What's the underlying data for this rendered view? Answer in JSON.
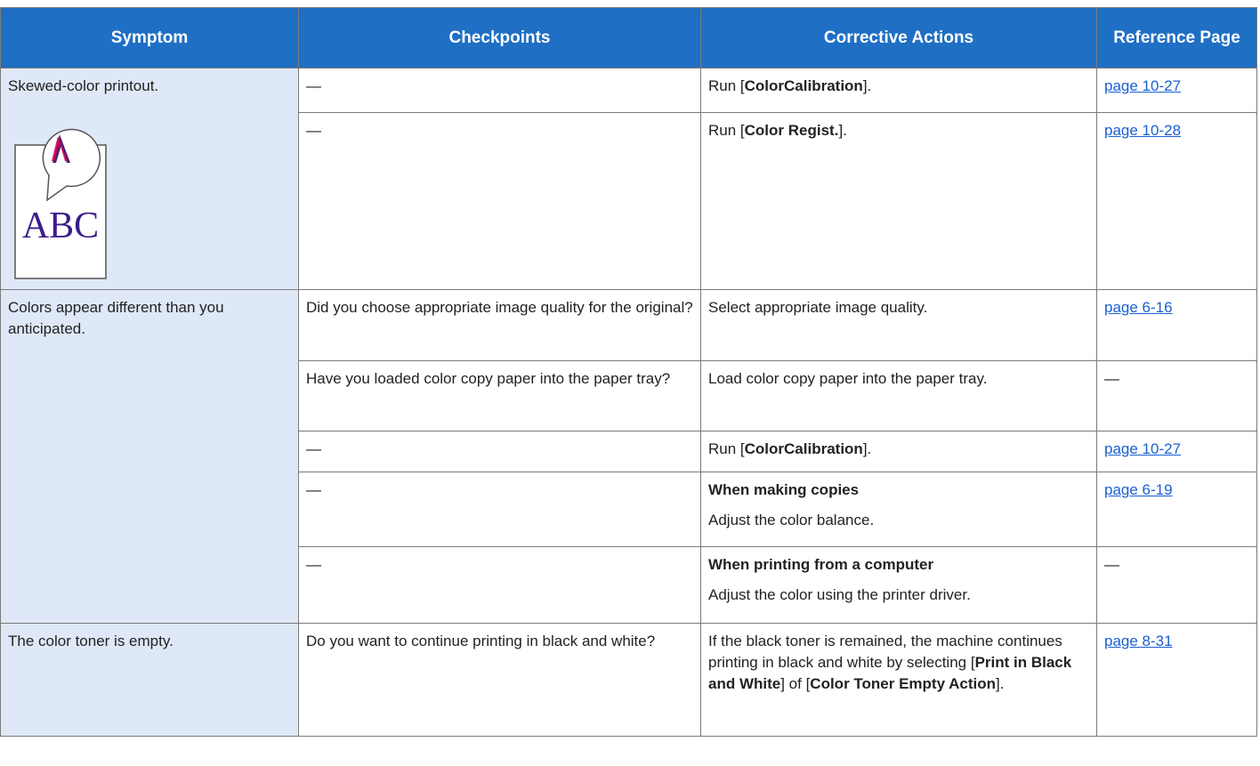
{
  "headers": {
    "symptom": "Symptom",
    "checkpoints": "Checkpoints",
    "corrective": "Corrective Actions",
    "reference": "Reference Page"
  },
  "dash": "—",
  "rows": [
    {
      "symptom": "Skewed-color printout.",
      "illustration_text": "ABC",
      "r1": {
        "check": "—",
        "action_pre": "Run [",
        "action_bold": "ColorCalibration",
        "action_post": "].",
        "ref": "page 10-27"
      },
      "r2": {
        "check": "—",
        "action_pre": "Run [",
        "action_bold": "Color Regist.",
        "action_post": "].",
        "ref": "page 10-28"
      }
    },
    {
      "symptom": "Colors appear different than you anticipated.",
      "r1": {
        "check": "Did you choose appropriate image quality for the original?",
        "action": "Select appropriate image quality.",
        "ref": "page 6-16"
      },
      "r2": {
        "check": "Have you loaded color copy paper into the paper tray?",
        "action": "Load color copy paper into the paper tray.",
        "ref": "—"
      },
      "r3": {
        "check": "—",
        "action_pre": "Run [",
        "action_bold": "ColorCalibration",
        "action_post": "].",
        "ref": "page 10-27"
      },
      "r4": {
        "check": "—",
        "action_heading": "When making copies",
        "action_body": "Adjust the color balance.",
        "ref": "page 6-19"
      },
      "r5": {
        "check": "—",
        "action_heading": "When printing from a computer",
        "action_body": "Adjust the color using the printer driver.",
        "ref": "—"
      }
    },
    {
      "symptom": "The color toner is empty.",
      "r1": {
        "check": "Do you want to continue printing in black and white?",
        "action_pre": "If the black toner is remained, the machine continues printing in black and white by selecting [",
        "action_bold1": "Print in Black and White",
        "action_mid": "] of [",
        "action_bold2": "Color Toner Empty Action",
        "action_post": "].",
        "ref": "page 8-31"
      }
    }
  ]
}
